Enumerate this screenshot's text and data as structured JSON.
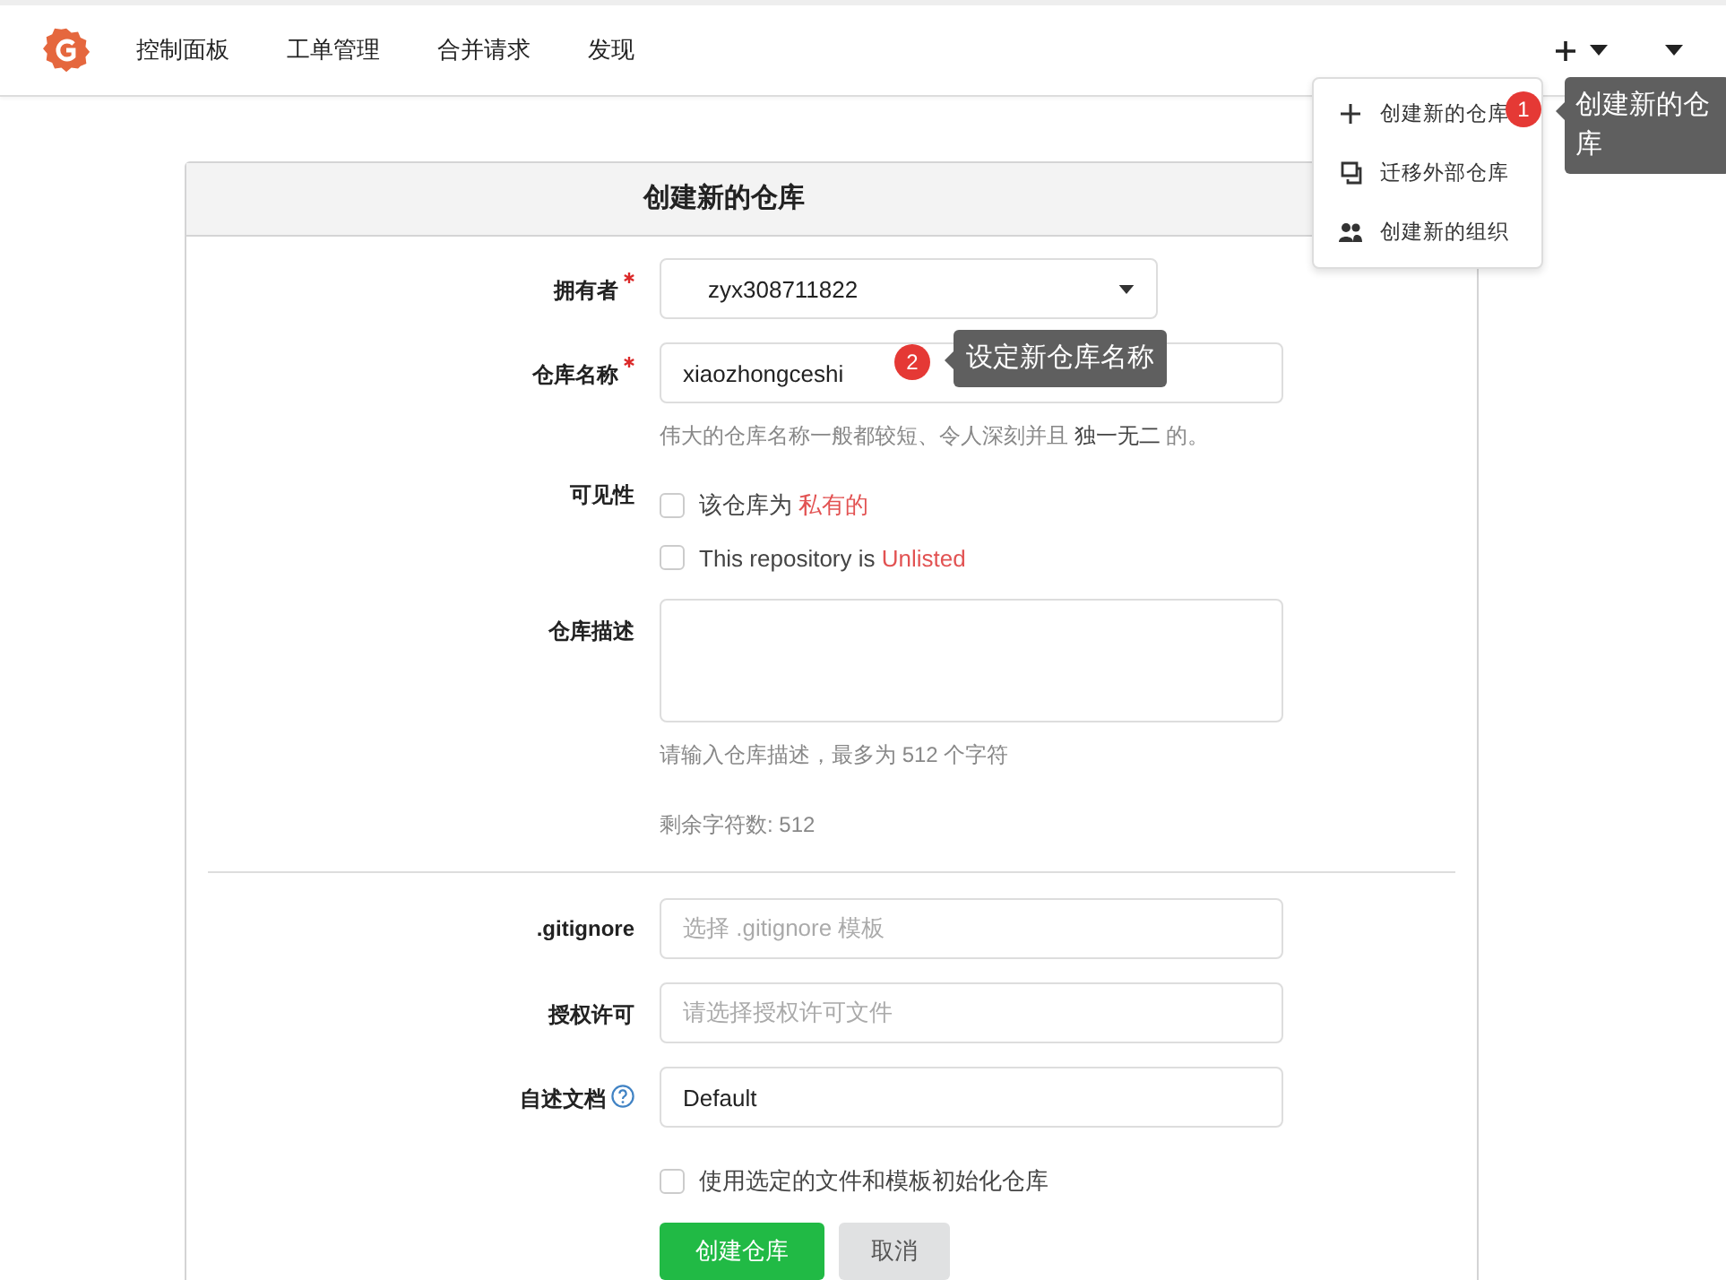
{
  "nav": {
    "items": [
      "控制面板",
      "工单管理",
      "合并请求",
      "发现"
    ]
  },
  "new_menu": {
    "items": [
      {
        "kind": "repo",
        "label": "创建新的仓库"
      },
      {
        "kind": "migrate",
        "label": "迁移外部仓库"
      },
      {
        "kind": "org",
        "label": "创建新的组织"
      }
    ]
  },
  "callouts": [
    {
      "number": "1",
      "text": "创建新的仓库"
    },
    {
      "number": "2",
      "text": "设定新仓库名称"
    }
  ],
  "form": {
    "title": "创建新的仓库",
    "main_fields": [
      {
        "kind": "select",
        "label": "拥有者",
        "required": true,
        "value": "zyx308711822"
      },
      {
        "kind": "input",
        "label": "仓库名称",
        "required": true,
        "value": "xiaozhongceshi",
        "help": [
          "伟大的仓库名称一般都较短、令人深刻并且 **独一无二** 的。"
        ]
      },
      {
        "kind": "checkboxes",
        "label": "可见性",
        "options": [
          {
            "text": "该仓库为 ",
            "highlight": "私有的",
            "checked": false
          },
          {
            "text": "This repository is ",
            "highlight": "Unlisted",
            "checked": false
          }
        ]
      },
      {
        "kind": "textarea",
        "label": "仓库描述",
        "help": [
          "请输入仓库描述，最多为 512 个字符",
          "剩余字符数: 512"
        ]
      }
    ],
    "template_fields": [
      {
        "kind": "select",
        "label": ".gitignore",
        "placeholder": "选择 .gitignore 模板"
      },
      {
        "kind": "select",
        "label": "授权许可",
        "placeholder": "请选择授权许可文件"
      },
      {
        "kind": "select",
        "label": "自述文档",
        "value": "Default",
        "help_icon": true
      },
      {
        "kind": "checkboxes",
        "options": [
          {
            "text": "使用选定的文件和模板初始化仓库",
            "checked": false
          }
        ]
      }
    ],
    "buttons": [
      {
        "kind": "primary",
        "label": "创建仓库"
      },
      {
        "kind": "secondary",
        "label": "取消"
      }
    ]
  }
}
